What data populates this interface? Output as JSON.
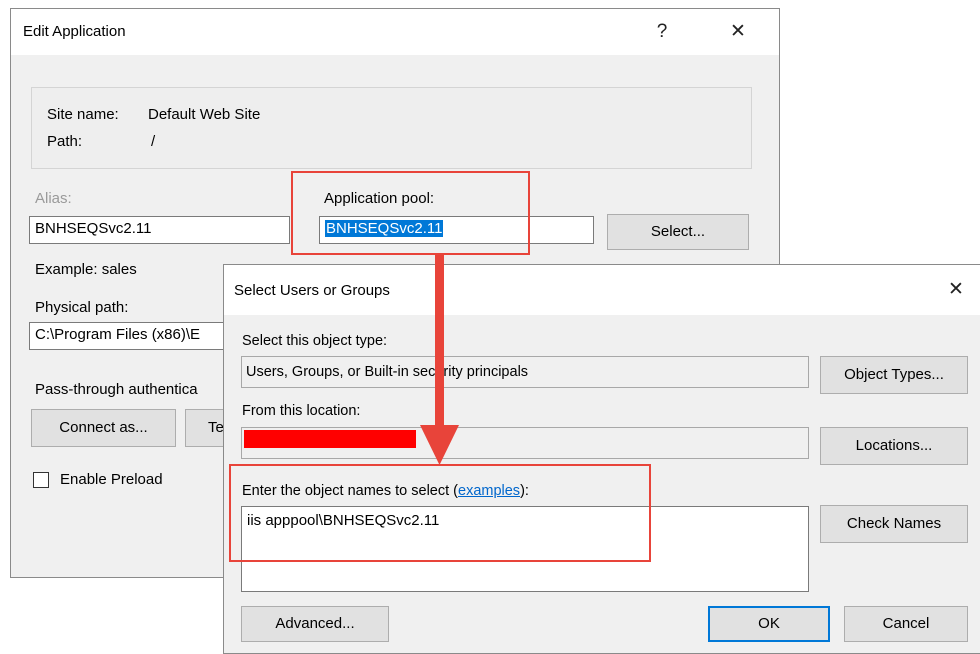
{
  "edit_app": {
    "title": "Edit Application",
    "help_glyph": "?",
    "close_glyph": "✕",
    "site_name_label": "Site name:",
    "site_name_value": "Default Web Site",
    "path_label": "Path:",
    "path_value": "/",
    "alias_label": "Alias:",
    "alias_value": "BNHSEQSvc2.11",
    "example_text": "Example: sales",
    "app_pool_label": "Application pool:",
    "app_pool_value": "BNHSEQSvc2.11",
    "select_button": "Select...",
    "physical_path_label": "Physical path:",
    "physical_path_value": "C:\\Program Files (x86)\\E",
    "pass_through_label": "Pass-through authentica",
    "connect_as_button": "Connect as...",
    "test_button_partial": "Te",
    "enable_preload_label": "Enable Preload",
    "enable_preload_checked": false
  },
  "select_users": {
    "title": "Select Users or Groups",
    "close_glyph": "✕",
    "object_type_label": "Select this object type:",
    "object_type_value": "Users, Groups, or Built-in security principals",
    "object_types_button": "Object Types...",
    "location_label": "From this location:",
    "locations_button": "Locations...",
    "enter_names_label_prefix": "Enter the object names to select (",
    "examples_link": "examples",
    "enter_names_label_suffix": "):",
    "names_value": "iis apppool\\BNHSEQSvc2.11",
    "check_names_button": "Check Names",
    "advanced_button": "Advanced...",
    "ok_button": "OK",
    "cancel_button": "Cancel"
  },
  "colors": {
    "highlight_box": "#e8443a",
    "arrow": "#e8443a",
    "redaction": "#ff0000",
    "selection": "#0078d7",
    "link": "#0066cc"
  }
}
